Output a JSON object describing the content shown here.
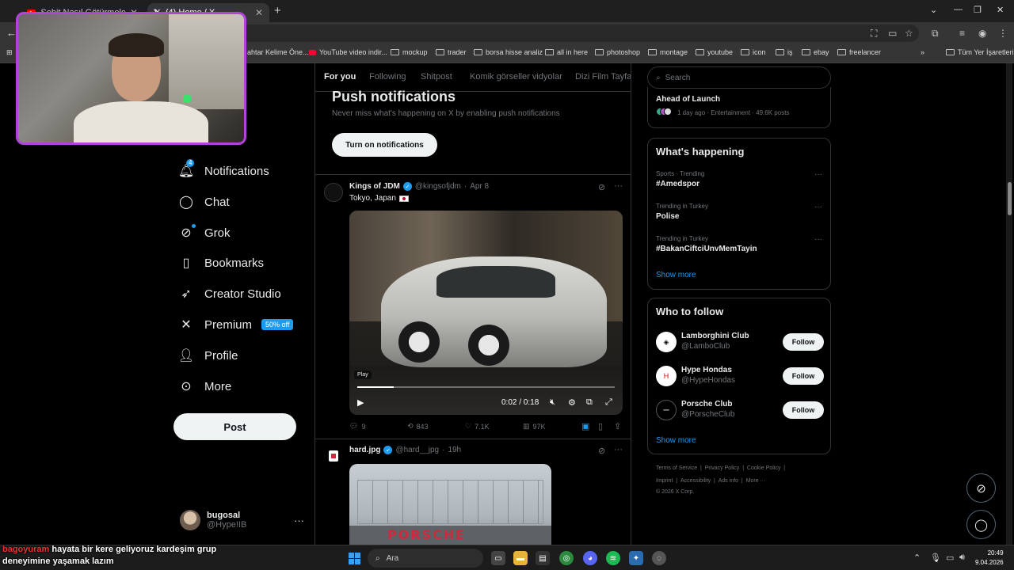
{
  "browser": {
    "tabs": [
      {
        "title": "Şehit Nasıl Götürmelerinin Se",
        "active": false
      },
      {
        "title": "(4) Home / X",
        "active": true
      }
    ],
    "new_tab_label": "+",
    "bookmarks": [
      "ahtar Kelime Öne...",
      "YouTube video indir...",
      "mockup",
      "trader",
      "borsa hisse analiz",
      "all in here",
      "photoshop",
      "montage",
      "youtube",
      "icon",
      "iş",
      "ebay",
      "freelancer"
    ],
    "all_bookmarks": "Tüm Yer İşaretleri"
  },
  "nav": {
    "items": [
      {
        "label": "Notifications",
        "icon": "bell-icon",
        "badge": "4"
      },
      {
        "label": "Chat",
        "icon": "chat-bubble-icon"
      },
      {
        "label": "Grok",
        "icon": "grok-icon"
      },
      {
        "label": "Bookmarks",
        "icon": "bookmark-icon"
      },
      {
        "label": "Creator Studio",
        "icon": "rocket-icon"
      },
      {
        "label": "Premium",
        "icon": "x-logo-icon",
        "pill": "50% off"
      },
      {
        "label": "Profile",
        "icon": "person-icon"
      },
      {
        "label": "More",
        "icon": "more-circle-icon"
      }
    ],
    "post_label": "Post",
    "account": {
      "name": "bugosal",
      "handle": "@Hype!IB"
    }
  },
  "feed": {
    "tabs": [
      "For you",
      "Following",
      "Shitpost",
      "Komik görseller vidyolar",
      "Dizi Film Tayfa"
    ],
    "push": {
      "title": "Push notifications",
      "subtitle": "Never miss what's happening on X by enabling push notifications",
      "button": "Turn on notifications"
    },
    "tweet1": {
      "name": "Kings of JDM",
      "handle": "@kingsofjdm",
      "date": "Apr 8",
      "text": "Tokyo, Japan",
      "video": {
        "play_label": "Play",
        "time": "0:02 / 0:18",
        "progress": 0.14
      },
      "replies": "9",
      "reposts": "843",
      "likes": "7.1K",
      "views": "97K"
    },
    "tweet2": {
      "name": "hard.jpg",
      "handle": "@hard__jpg",
      "date": "19h",
      "image_text": "PORSCHE"
    }
  },
  "right": {
    "search_placeholder": "Search",
    "top_card": {
      "title": "Ahead of Launch",
      "meta": "1 day ago · Entertainment · 49.6K posts"
    },
    "whats_happening": {
      "title": "What's happening",
      "trends": [
        {
          "category": "Sports · Trending",
          "name": "#Amedspor"
        },
        {
          "category": "Trending in Turkey",
          "name": "Polise"
        },
        {
          "category": "Trending in Turkey",
          "name": "#BakanCiftciUnvMemTayin"
        }
      ],
      "show_more": "Show more"
    },
    "who_to_follow": {
      "title": "Who to follow",
      "accounts": [
        {
          "name": "Lamborghini Club",
          "handle": "@LamboClub"
        },
        {
          "name": "Hype Hondas",
          "handle": "@HypeHondas"
        },
        {
          "name": "Porsche Club",
          "handle": "@PorscheClub"
        }
      ],
      "follow_label": "Follow",
      "show_more": "Show more"
    },
    "footer": {
      "line1": [
        "Terms of Service",
        "Privacy Policy",
        "Cookie Policy"
      ],
      "line2": [
        "Imprint",
        "Accessibility",
        "Ads info",
        "More ···"
      ],
      "copyright": "© 2026 X Corp."
    }
  },
  "chat_overlay": {
    "user": "bagoyuram",
    "line1": "hayata bir kere geliyoruz kardeşim grup",
    "line2": "deneyimine yaşamak lazım"
  },
  "taskbar": {
    "search_label": "Ara",
    "time": "20:49",
    "date": "9.04.2026"
  },
  "colors": {
    "accent": "#1d9bf0",
    "webcam_border": "#b044d8",
    "background": "#000000"
  }
}
